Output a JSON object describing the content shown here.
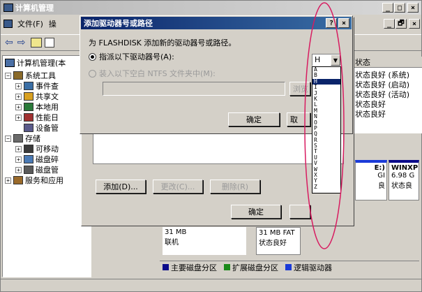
{
  "main_window": {
    "title": "计算机管理",
    "menu": [
      "文件(F)",
      "操"
    ],
    "controls": {
      "min": "_",
      "max": "□",
      "close": "×"
    },
    "inner_controls": {
      "min": "_",
      "max": "🗗",
      "close": "×"
    }
  },
  "tree": {
    "root": "计算机管理(本",
    "items": [
      {
        "label": "系统工具",
        "level": 1,
        "icon": "tools-icon"
      },
      {
        "label": "事件查",
        "level": 2,
        "icon": "event-icon"
      },
      {
        "label": "共享文",
        "level": 2,
        "icon": "share-icon"
      },
      {
        "label": "本地用",
        "level": 2,
        "icon": "users-icon"
      },
      {
        "label": "性能日",
        "level": 2,
        "icon": "perf-icon"
      },
      {
        "label": "设备管",
        "level": 2,
        "icon": "device-icon"
      },
      {
        "label": "存储",
        "level": 1,
        "icon": "storage-icon"
      },
      {
        "label": "可移动",
        "level": 2,
        "icon": "removable-icon"
      },
      {
        "label": "磁盘碎",
        "level": 2,
        "icon": "defrag-icon"
      },
      {
        "label": "磁盘管",
        "level": 2,
        "icon": "diskmgmt-icon"
      },
      {
        "label": "服务和应用",
        "level": 1,
        "icon": "services-icon"
      }
    ]
  },
  "status_column": {
    "header": "状态",
    "rows": [
      "状态良好 (系统)",
      "状态良好 (启动)",
      "状态良好 (活动)",
      "状态良好",
      "状态良好"
    ]
  },
  "disk_panels": {
    "p1": [
      "E:)",
      "GI",
      "良"
    ],
    "p2": [
      "WINXP",
      "6.98 G",
      "状态良"
    ],
    "p3": [
      "31 MB",
      "联机"
    ],
    "p4": [
      "31 MB FAT",
      "状态良好"
    ]
  },
  "legend": [
    {
      "label": "主要磁盘分区",
      "color": "#0a0a8a"
    },
    {
      "label": "扩展磁盘分区",
      "color": "#1a8a1a"
    },
    {
      "label": "逻辑驱动器",
      "color": "#1a3ad8"
    }
  ],
  "back_dialog": {
    "add_button": "添加(D)...",
    "change_button": "更改(C)...",
    "delete_button": "删除(R)",
    "ok_button": "确定"
  },
  "dialog": {
    "title": "添加驱动器号或路径",
    "help": "?",
    "close": "×",
    "description": "为 FLASHDISK 添加新的驱动器号或路径。",
    "option_letter": "指派以下驱动器号(A):",
    "option_folder": "装入以下空白 NTFS 文件夹中(M):",
    "browse_button": "浏览",
    "ok_button": "确定",
    "cancel_button": "取",
    "selected_letter": "H",
    "letters": [
      "A",
      "B",
      "H",
      "I",
      "J",
      "K",
      "L",
      "M",
      "N",
      "O",
      "P",
      "Q",
      "R",
      "S",
      "T",
      "U",
      "V",
      "W",
      "X",
      "Y",
      "Z"
    ],
    "highlighted_index": 2,
    "accent": "#0a246a",
    "annotation_color": "#d81b60"
  }
}
